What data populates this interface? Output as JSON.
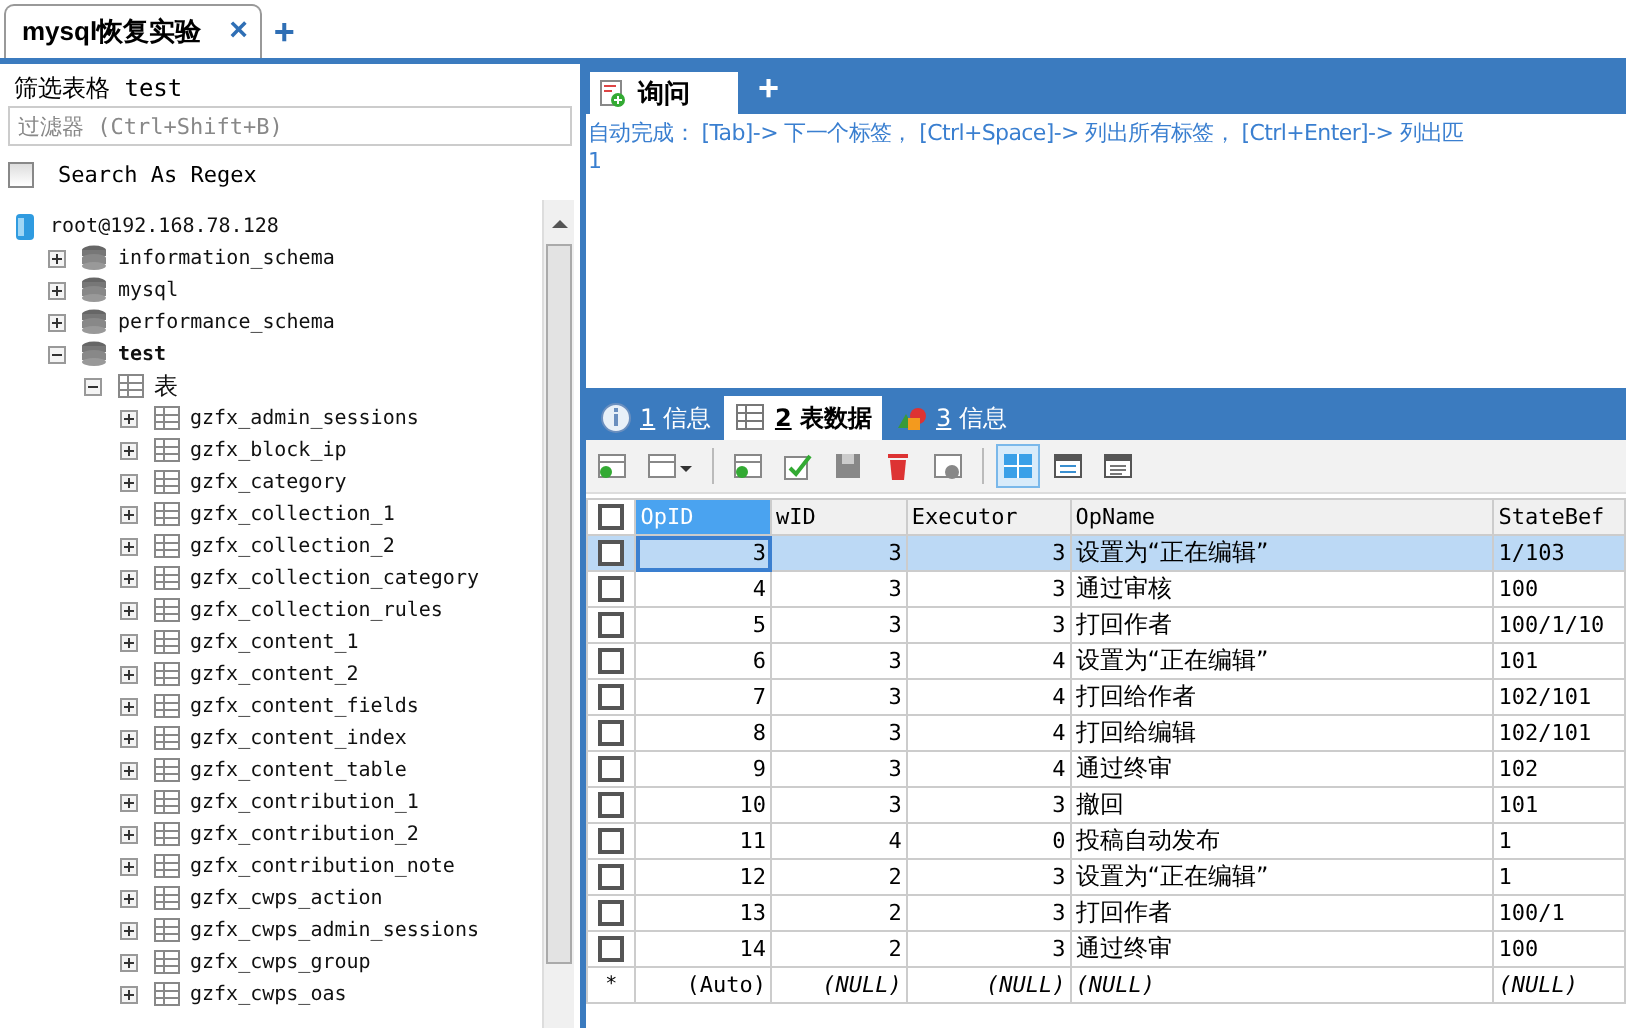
{
  "window_tabs": [
    {
      "label": "mysql恢复实验",
      "selected": true,
      "close": "×"
    }
  ],
  "new_tab": "+",
  "filter": {
    "label": "筛选表格 test",
    "placeholder": "过滤器 (Ctrl+Shift+B)"
  },
  "regex": {
    "label": "Search As Regex",
    "checked": false
  },
  "tree": [
    {
      "label": "root@192.168.78.128",
      "kind": "connection",
      "bold": false,
      "children": [
        {
          "label": "information_schema",
          "kind": "database",
          "expanded": false,
          "bold": false
        },
        {
          "label": "mysql",
          "kind": "database",
          "expanded": false,
          "bold": false
        },
        {
          "label": "performance_schema",
          "kind": "database",
          "expanded": false,
          "bold": false
        },
        {
          "label": "test",
          "kind": "database",
          "expanded": true,
          "bold": true,
          "children": [
            {
              "label": "表",
              "kind": "folder",
              "expanded": true,
              "bold": false,
              "children": [
                {
                  "label": "gzfx_admin_sessions",
                  "kind": "table",
                  "expanded": false
                },
                {
                  "label": "gzfx_block_ip",
                  "kind": "table",
                  "expanded": false
                },
                {
                  "label": "gzfx_category",
                  "kind": "table",
                  "expanded": false
                },
                {
                  "label": "gzfx_collection_1",
                  "kind": "table",
                  "expanded": false
                },
                {
                  "label": "gzfx_collection_2",
                  "kind": "table",
                  "expanded": false
                },
                {
                  "label": "gzfx_collection_category",
                  "kind": "table",
                  "expanded": false
                },
                {
                  "label": "gzfx_collection_rules",
                  "kind": "table",
                  "expanded": false
                },
                {
                  "label": "gzfx_content_1",
                  "kind": "table",
                  "expanded": false
                },
                {
                  "label": "gzfx_content_2",
                  "kind": "table",
                  "expanded": false
                },
                {
                  "label": "gzfx_content_fields",
                  "kind": "table",
                  "expanded": false
                },
                {
                  "label": "gzfx_content_index",
                  "kind": "table",
                  "expanded": false
                },
                {
                  "label": "gzfx_content_table",
                  "kind": "table",
                  "expanded": false
                },
                {
                  "label": "gzfx_contribution_1",
                  "kind": "table",
                  "expanded": false
                },
                {
                  "label": "gzfx_contribution_2",
                  "kind": "table",
                  "expanded": false
                },
                {
                  "label": "gzfx_contribution_note",
                  "kind": "table",
                  "expanded": false
                },
                {
                  "label": "gzfx_cwps_action",
                  "kind": "table",
                  "expanded": false
                },
                {
                  "label": "gzfx_cwps_admin_sessions",
                  "kind": "table",
                  "expanded": false
                },
                {
                  "label": "gzfx_cwps_group",
                  "kind": "table",
                  "expanded": false
                },
                {
                  "label": "gzfx_cwps_oas",
                  "kind": "table",
                  "expanded": false
                }
              ]
            }
          ]
        }
      ]
    }
  ],
  "query_tabs": [
    {
      "label": "询问",
      "selected": true
    }
  ],
  "query_new_tab": "+",
  "editor": {
    "hint": "自动完成： [Tab]-> 下一个标签， [Ctrl+Space]-> 列出所有标签， [Ctrl+Enter]-> 列出匹",
    "line_numbers": [
      "1"
    ]
  },
  "result_tabs": [
    {
      "number": "1",
      "label": "信息",
      "kind": "info",
      "selected": false
    },
    {
      "number": "2",
      "label": "表数据",
      "kind": "table",
      "selected": true
    },
    {
      "number": "3",
      "label": "信息",
      "kind": "profile",
      "selected": false
    }
  ],
  "view_modes": [
    {
      "kind": "grid",
      "selected": true
    },
    {
      "kind": "form",
      "selected": false
    },
    {
      "kind": "text",
      "selected": false
    }
  ],
  "table": {
    "header_checked": false,
    "columns": [
      "OpID",
      "wID",
      "Executor",
      "OpName",
      "StateBef"
    ],
    "rows": [
      {
        "selected": true,
        "checked": false,
        "cells": [
          "3",
          "3",
          "3",
          "设置为“正在编辑”",
          "1/103"
        ]
      },
      {
        "selected": false,
        "checked": false,
        "cells": [
          "4",
          "3",
          "3",
          "通过审核",
          "100"
        ]
      },
      {
        "selected": false,
        "checked": false,
        "cells": [
          "5",
          "3",
          "3",
          "打回作者",
          "100/1/10"
        ]
      },
      {
        "selected": false,
        "checked": false,
        "cells": [
          "6",
          "3",
          "4",
          "设置为“正在编辑”",
          "101"
        ]
      },
      {
        "selected": false,
        "checked": false,
        "cells": [
          "7",
          "3",
          "4",
          "打回给作者",
          "102/101"
        ]
      },
      {
        "selected": false,
        "checked": false,
        "cells": [
          "8",
          "3",
          "4",
          "打回给编辑",
          "102/101"
        ]
      },
      {
        "selected": false,
        "checked": false,
        "cells": [
          "9",
          "3",
          "4",
          "通过终审",
          "102"
        ]
      },
      {
        "selected": false,
        "checked": false,
        "cells": [
          "10",
          "3",
          "3",
          "撤回",
          "101"
        ]
      },
      {
        "selected": false,
        "checked": false,
        "cells": [
          "11",
          "4",
          "0",
          "投稿自动发布",
          "1"
        ]
      },
      {
        "selected": false,
        "checked": false,
        "cells": [
          "12",
          "2",
          "3",
          "设置为“正在编辑”",
          "1"
        ]
      },
      {
        "selected": false,
        "checked": false,
        "cells": [
          "13",
          "2",
          "3",
          "打回作者",
          "100/1"
        ]
      },
      {
        "selected": false,
        "checked": false,
        "cells": [
          "14",
          "2",
          "3",
          "通过终审",
          "100"
        ]
      }
    ],
    "new_row": {
      "marker": "*",
      "cells": [
        "(Auto)",
        "(NULL)",
        "(NULL)",
        "(NULL)",
        "(NULL)"
      ]
    }
  }
}
